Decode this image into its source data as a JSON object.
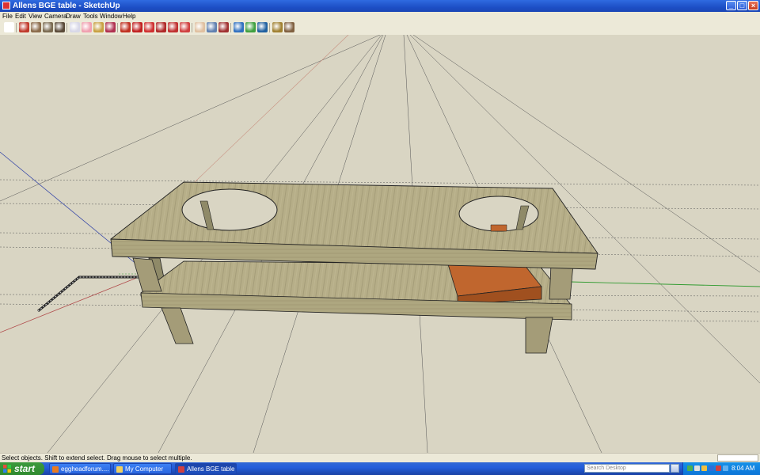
{
  "window": {
    "title": "Allens BGE table - SketchUp",
    "minimize_icon": "minimize-icon",
    "maximize_icon": "maximize-icon",
    "close_icon": "close-icon"
  },
  "menu": [
    "File",
    "Edit",
    "View",
    "Camera",
    "Draw",
    "Tools",
    "Window",
    "Help"
  ],
  "toolbar": {
    "tools": [
      {
        "name": "select-tool",
        "color": "#ffffff"
      },
      {
        "name": "pencil-tool",
        "color": "#c0392b"
      },
      {
        "name": "rectangle-tool",
        "color": "#8b6b4a"
      },
      {
        "name": "circle-tool",
        "color": "#7a6a50"
      },
      {
        "name": "arc-tool",
        "color": "#5a4a38"
      },
      {
        "name": "make-component-tool",
        "color": "#d8d8e8"
      },
      {
        "name": "eraser-tool",
        "color": "#f0a0b0"
      },
      {
        "name": "tape-measure-tool",
        "color": "#c8a040"
      },
      {
        "name": "paint-bucket-tool",
        "color": "#b03050"
      },
      {
        "name": "push-pull-tool",
        "color": "#c03020"
      },
      {
        "name": "move-tool",
        "color": "#c02020"
      },
      {
        "name": "rotate-tool",
        "color": "#d03030"
      },
      {
        "name": "follow-me-tool",
        "color": "#b02828"
      },
      {
        "name": "offset-tool",
        "color": "#c03030"
      },
      {
        "name": "orbit-tool",
        "color": "#d04040"
      },
      {
        "name": "pan-tool",
        "color": "#e0c0a0"
      },
      {
        "name": "zoom-tool",
        "color": "#6080b0"
      },
      {
        "name": "zoom-extents-tool",
        "color": "#a03030"
      },
      {
        "name": "get-models-tool",
        "color": "#3070c0"
      },
      {
        "name": "share-model-tool",
        "color": "#40a040"
      },
      {
        "name": "google-earth-tool",
        "color": "#2060a0"
      },
      {
        "name": "get-current-view-tool",
        "color": "#a08030"
      },
      {
        "name": "toggle-terrain-tool",
        "color": "#806040"
      }
    ]
  },
  "status": {
    "text": "Select objects. Shift to extend select. Drag mouse to select multiple."
  },
  "taskbar": {
    "start_label": "start",
    "tasks": [
      {
        "label": "eggheadforum....",
        "icon_color": "#e87a20",
        "active": false
      },
      {
        "label": "My Computer",
        "icon_color": "#f0d060",
        "active": false
      },
      {
        "label": "Allens BGE table ...",
        "icon_color": "#d04040",
        "active": true
      }
    ],
    "search_placeholder": "Search Desktop",
    "clock": "8:04 AM"
  },
  "colors": {
    "viewport_bg": "#d9d5c3",
    "wood_light": "#b9b28c",
    "wood_dark": "#8f8a68",
    "drawer": "#c0662e"
  }
}
